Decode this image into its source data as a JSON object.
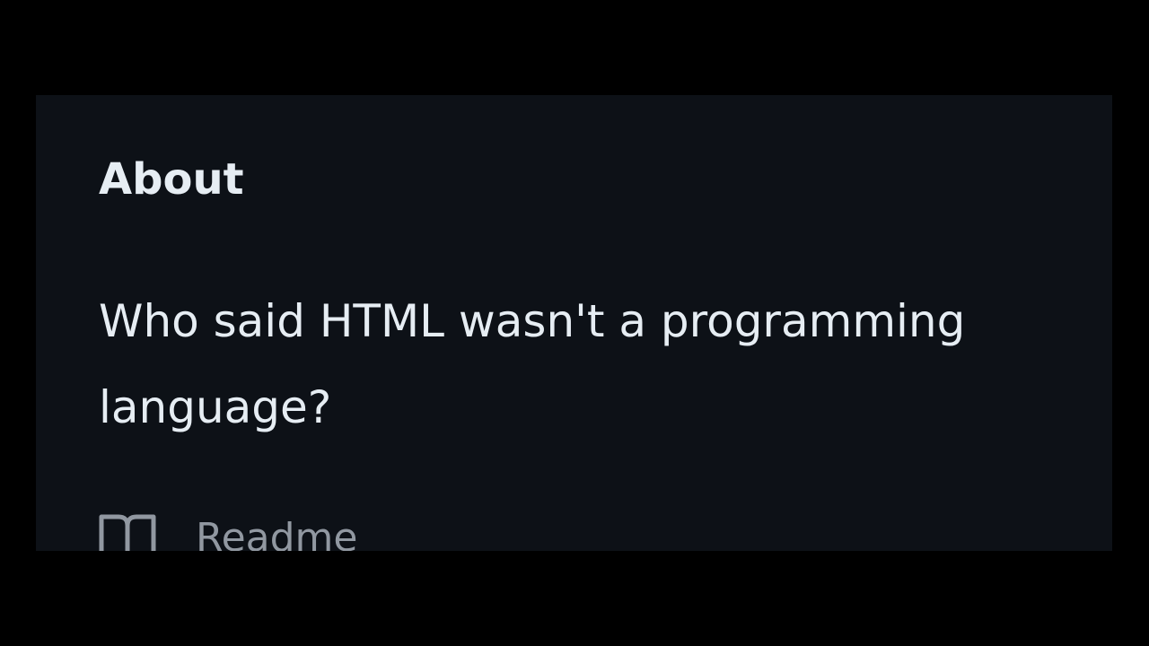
{
  "about": {
    "heading": "About",
    "description": "Who said HTML wasn't a programming language?",
    "readme_label": "Readme",
    "readme_icon": "book-icon"
  },
  "colors": {
    "background": "#000000",
    "panel": "#0d1117",
    "text_primary": "#e6edf3",
    "text_muted": "#9198a1"
  }
}
